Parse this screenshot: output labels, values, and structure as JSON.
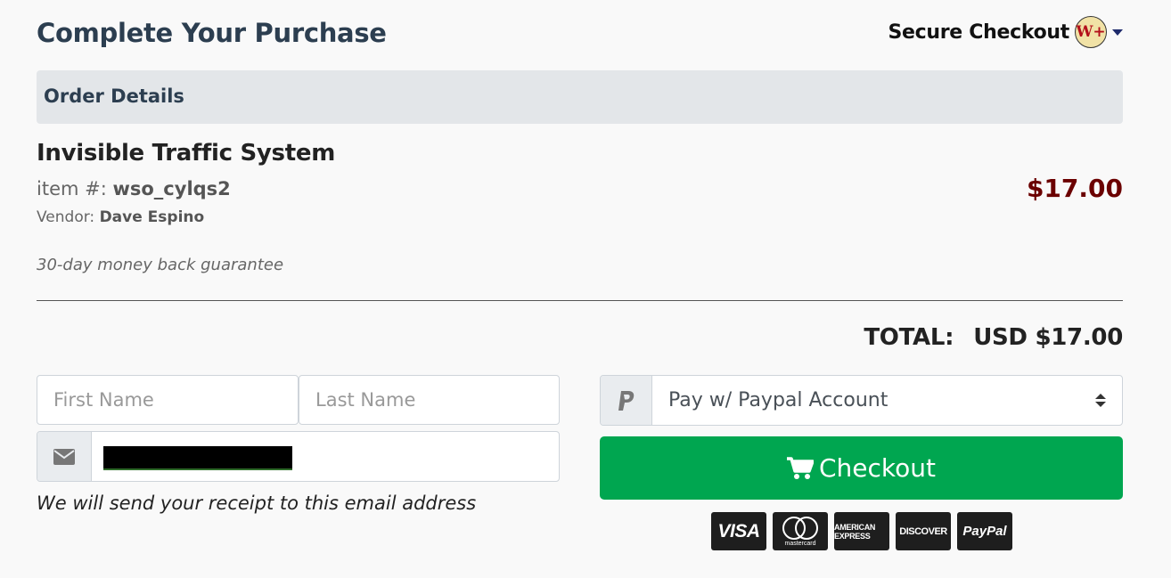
{
  "header": {
    "title": "Complete Your Purchase",
    "secure_label": "Secure Checkout",
    "logo_text": "W+",
    "logo_icon": "warriorplus-logo"
  },
  "order": {
    "section_title": "Order Details",
    "product_name": "Invisible Traffic System",
    "item_label": "item #:",
    "item_number": "wso_cylqs2",
    "vendor_label": "Vendor:",
    "vendor_name": "Dave Espino",
    "price": "$17.00",
    "guarantee": "30-day money back guarantee",
    "total_label": "TOTAL:",
    "total_value": "USD $17.00"
  },
  "form": {
    "first_name_placeholder": "First Name",
    "first_name_value": "",
    "last_name_placeholder": "Last Name",
    "last_name_value": "",
    "email_icon": "envelope-icon",
    "email_note": "We will send your receipt to this email address"
  },
  "payment": {
    "method_icon": "paypal-icon",
    "selected_method": "Pay w/ Paypal Account",
    "checkout_label": "Checkout",
    "checkout_icon": "shopping-cart-icon",
    "cards": [
      "VISA",
      "mastercard",
      "AMERICAN EXPRESS",
      "DISCOVER",
      "PayPal"
    ]
  },
  "colors": {
    "background": "#f9f9f9",
    "title": "#2c3e50",
    "price": "#6b0000",
    "checkout_button": "#00a650",
    "order_header_bg": "#e3e6e9"
  }
}
